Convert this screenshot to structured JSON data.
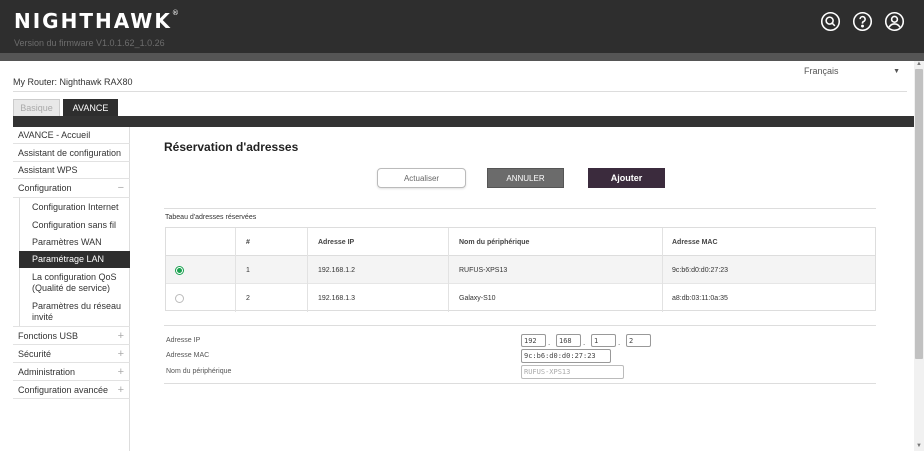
{
  "header": {
    "brand": "NIGHTHAWK",
    "trademark": "®",
    "firmware": "Version du firmware V1.0.1.62_1.0.26"
  },
  "router": {
    "label": "My Router: Nighthawk RAX80"
  },
  "language": {
    "selected": "Français"
  },
  "tabs": [
    {
      "label": "Basique",
      "active": false
    },
    {
      "label": "AVANCE",
      "active": true
    }
  ],
  "sidebar": {
    "items": [
      {
        "label": "AVANCE - Accueil"
      },
      {
        "label": "Assistant de configuration"
      },
      {
        "label": "Assistant WPS"
      },
      {
        "label": "Configuration",
        "sign": "−"
      },
      {
        "label": "Fonctions USB",
        "sign": "+"
      },
      {
        "label": "Sécurité",
        "sign": "+"
      },
      {
        "label": "Administration",
        "sign": "+"
      },
      {
        "label": "Configuration avancée",
        "sign": "+"
      }
    ],
    "sub_items": [
      {
        "label": "Configuration Internet"
      },
      {
        "label": "Configuration sans fil"
      },
      {
        "label": "Paramètres WAN"
      },
      {
        "label": "Paramétrage LAN",
        "active": true
      },
      {
        "label": "La configuration QoS (Qualité de service)"
      },
      {
        "label": "Paramètres du réseau invité"
      }
    ]
  },
  "main": {
    "title": "Réservation d'adresses",
    "buttons": {
      "refresh": "Actualiser",
      "cancel": "ANNULER",
      "add": "Ajouter"
    },
    "table": {
      "title": "Tabeau d'adresses réservées",
      "headers": [
        "",
        "#",
        "Adresse IP",
        "Nom du périphérique",
        "Adresse MAC"
      ],
      "rows": [
        {
          "selected": true,
          "num": "1",
          "ip": "192.168.1.2",
          "name": "RUFUS-XPS13",
          "mac": "9c:b6:d0:d0:27:23"
        },
        {
          "selected": false,
          "num": "2",
          "ip": "192.168.1.3",
          "name": "Galaxy-S10",
          "mac": "a8:db:03:11:0a:35"
        }
      ]
    },
    "form": {
      "ip_label": "Adresse IP",
      "ip_octets": [
        "192",
        "168",
        "1",
        "2"
      ],
      "ip_separator": ".",
      "mac_label": "Adresse MAC",
      "mac_value": "9c:b6:d0:d0:27:23",
      "name_label": "Nom du périphérique",
      "name_value": "RUFUS-XPS13"
    }
  },
  "colors": {
    "header_bg": "#2e2e2e",
    "add_button": "#3b2b3d",
    "cancel_button": "#6b6b6b",
    "radio_checked": "#19a14f"
  },
  "icons": [
    "search-icon",
    "help-icon",
    "user-icon",
    "chevron-down-icon"
  ]
}
